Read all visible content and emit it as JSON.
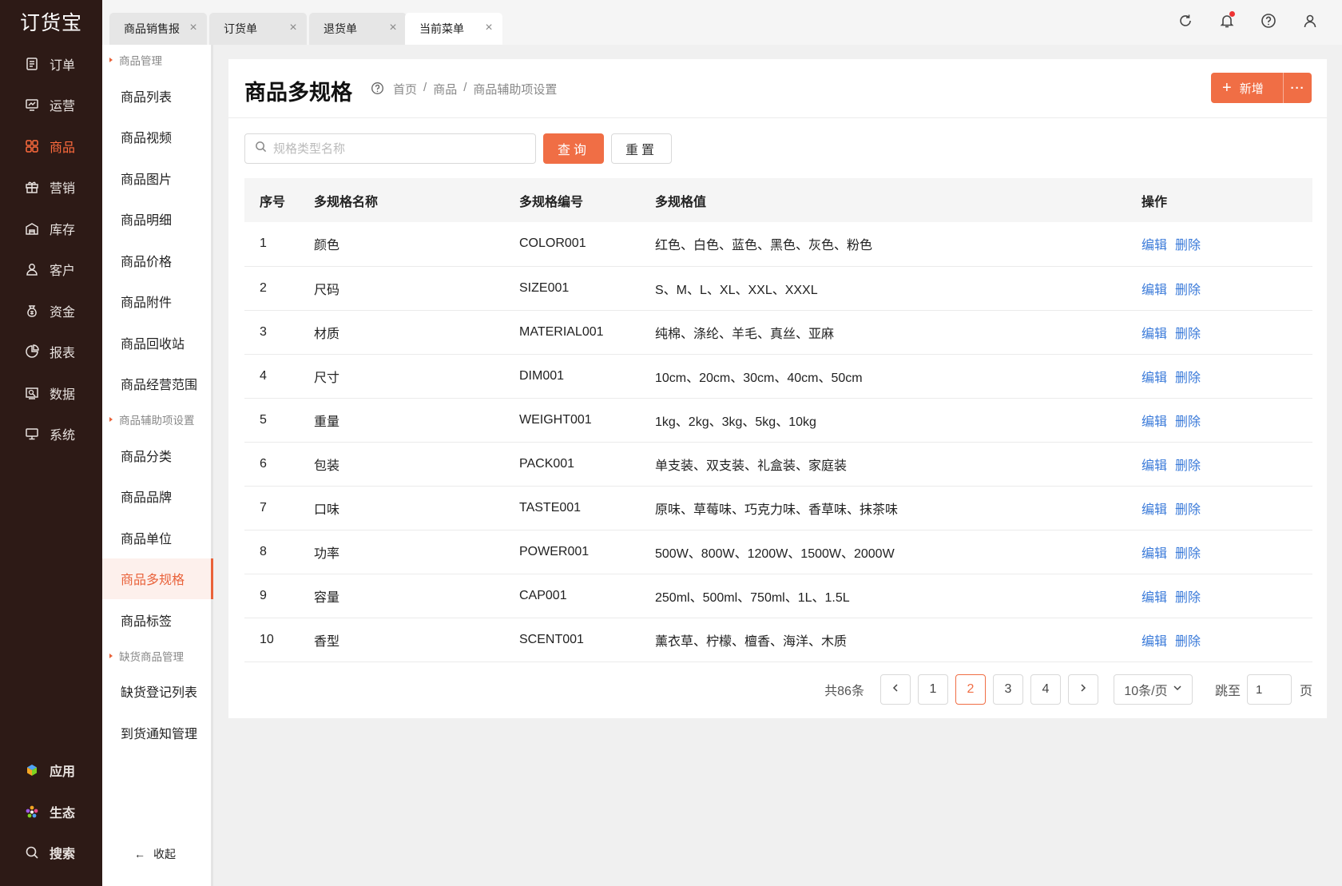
{
  "app": {
    "logo": "订货宝"
  },
  "rail": {
    "items": [
      {
        "label": "订单",
        "icon": "order-icon"
      },
      {
        "label": "运营",
        "icon": "operations-icon"
      },
      {
        "label": "商品",
        "icon": "goods-icon",
        "active": true
      },
      {
        "label": "营销",
        "icon": "gift-icon"
      },
      {
        "label": "库存",
        "icon": "warehouse-icon"
      },
      {
        "label": "客户",
        "icon": "customer-icon"
      },
      {
        "label": "资金",
        "icon": "money-bag-icon"
      },
      {
        "label": "报表",
        "icon": "pie-chart-icon"
      },
      {
        "label": "数据",
        "icon": "data-icon"
      },
      {
        "label": "系统",
        "icon": "monitor-icon"
      }
    ],
    "bottom": [
      {
        "label": "应用",
        "icon": "cube-icon"
      },
      {
        "label": "生态",
        "icon": "flower-icon"
      },
      {
        "label": "搜索",
        "icon": "search-icon"
      }
    ]
  },
  "submenu": {
    "group1": "商品管理",
    "items1": [
      "商品列表",
      "商品视频",
      "商品图片",
      "商品明细",
      "商品价格",
      "商品附件",
      "商品回收站",
      "商品经营范围"
    ],
    "group2": "商品辅助项设置",
    "items2": [
      "商品分类",
      "商品品牌",
      "商品单位",
      "商品多规格",
      "商品标签"
    ],
    "group3": "缺货商品管理",
    "items3": [
      "缺货登记列表",
      "到货通知管理"
    ],
    "collapse": "收起"
  },
  "tabs": [
    {
      "label": "商品销售报"
    },
    {
      "label": "订货单"
    },
    {
      "label": "退货单"
    },
    {
      "label": "当前菜单"
    }
  ],
  "page": {
    "title": "商品多规格",
    "breadcrumb": [
      "首页",
      "/",
      "商品",
      "/",
      "商品辅助项设置"
    ],
    "add_label": "新增",
    "more_label": "···",
    "search_placeholder": "规格类型名称",
    "query_label": "查询",
    "reset_label": "重置"
  },
  "table": {
    "headers": [
      "序号",
      "多规格名称",
      "多规格编号",
      "多规格值",
      "操作"
    ],
    "edit_label": "编辑",
    "delete_label": "删除",
    "rows": [
      [
        "1",
        "颜色",
        "COLOR001",
        "红色、白色、蓝色、黑色、灰色、粉色"
      ],
      [
        "2",
        "尺码",
        "SIZE001",
        "S、M、L、XL、XXL、XXXL"
      ],
      [
        "3",
        "材质",
        "MATERIAL001",
        "纯棉、涤纶、羊毛、真丝、亚麻"
      ],
      [
        "4",
        "尺寸",
        "DIM001",
        "10cm、20cm、30cm、40cm、50cm"
      ],
      [
        "5",
        "重量",
        "WEIGHT001",
        "1kg、2kg、3kg、5kg、10kg"
      ],
      [
        "6",
        "包装",
        "PACK001",
        "单支装、双支装、礼盒装、家庭装"
      ],
      [
        "7",
        "口味",
        "TASTE001",
        "原味、草莓味、巧克力味、香草味、抹茶味"
      ],
      [
        "8",
        "功率",
        "POWER001",
        "500W、800W、1200W、1500W、2000W"
      ],
      [
        "9",
        "容量",
        "CAP001",
        "250ml、500ml、750ml、1L、1.5L"
      ],
      [
        "10",
        "香型",
        "SCENT001",
        "薰衣草、柠檬、檀香、海洋、木质"
      ]
    ]
  },
  "pager": {
    "total": "共86条",
    "pages": [
      "1",
      "2",
      "3",
      "4"
    ],
    "current": "2",
    "size": "10条/页",
    "jump_label": "跳至",
    "jump_value": "1",
    "jump_suffix": "页"
  },
  "colors": {
    "accent": "#f06e45",
    "rail_bg": "#2d1a16",
    "link": "#3a7ad9"
  }
}
